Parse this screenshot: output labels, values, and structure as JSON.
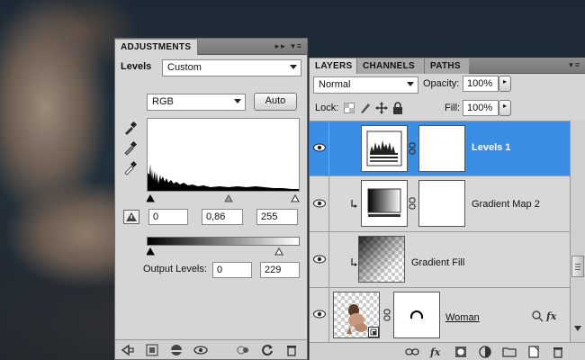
{
  "adjustments": {
    "tab_label": "ADJUSTMENTS",
    "type_label": "Levels",
    "preset_value": "Custom",
    "channel_value": "RGB",
    "auto_label": "Auto",
    "input_black": "0",
    "input_gamma": "0,86",
    "input_white": "255",
    "output_label": "Output Levels:",
    "output_black": "0",
    "output_white": "229"
  },
  "layers_panel": {
    "tabs": [
      {
        "label": "LAYERS",
        "active": true
      },
      {
        "label": "CHANNELS",
        "active": false
      },
      {
        "label": "PATHS",
        "active": false
      }
    ],
    "blend_mode": "Normal",
    "opacity_label": "Opacity:",
    "opacity_value": "100%",
    "lock_label": "Lock:",
    "fill_label": "Fill:",
    "fill_value": "100%",
    "layers": [
      {
        "name": "Levels 1",
        "selected": true
      },
      {
        "name": "Gradient Map 2",
        "selected": false
      },
      {
        "name": "Gradient Fill",
        "selected": false
      },
      {
        "name": "Woman",
        "selected": false
      }
    ]
  },
  "colors": {
    "selection": "#3a8ee6",
    "panel_bg": "#d6d6d6"
  }
}
